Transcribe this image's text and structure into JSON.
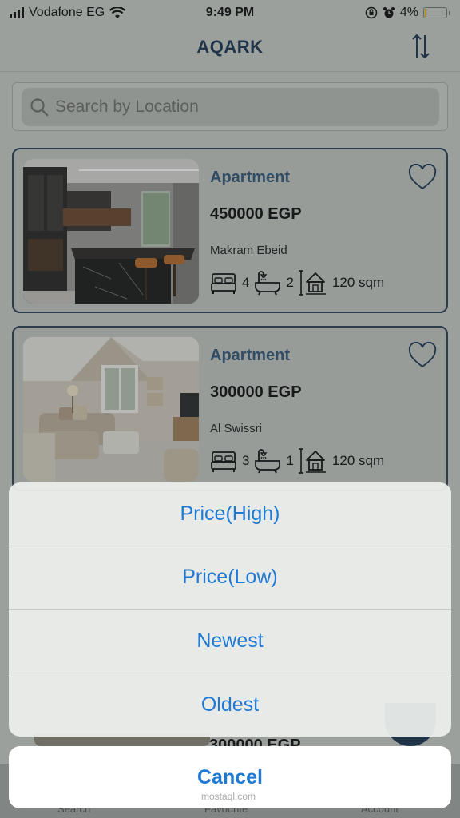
{
  "status_bar": {
    "carrier": "Vodafone EG",
    "time": "9:49 PM",
    "battery": "4%",
    "battery_level": 0.04,
    "battery_color": "#e8b300"
  },
  "header": {
    "title": "AQARK",
    "sort_icon": "sort-arrows-icon"
  },
  "search": {
    "placeholder": "Search by Location",
    "icon": "search-icon"
  },
  "listings": [
    {
      "type": "Apartment",
      "price": "450000 EGP",
      "location": "Makram Ebeid",
      "bedrooms": "4",
      "bathrooms": "2",
      "area": "120 sqm"
    },
    {
      "type": "Apartment",
      "price": "300000 EGP",
      "location": "Al Swissri",
      "bedrooms": "3",
      "bathrooms": "1",
      "area": "120 sqm"
    },
    {
      "price": "300000 EGP"
    }
  ],
  "tab_bar": {
    "items": [
      "Search",
      "Favourite",
      "Account"
    ]
  },
  "action_sheet": {
    "options": [
      "Price(High)",
      "Price(Low)",
      "Newest",
      "Oldest"
    ],
    "cancel": "Cancel"
  },
  "watermark": "mostaql.com",
  "colors": {
    "brand": "#1d3552",
    "accent": "#36587b",
    "action": "#1f7ad6"
  }
}
